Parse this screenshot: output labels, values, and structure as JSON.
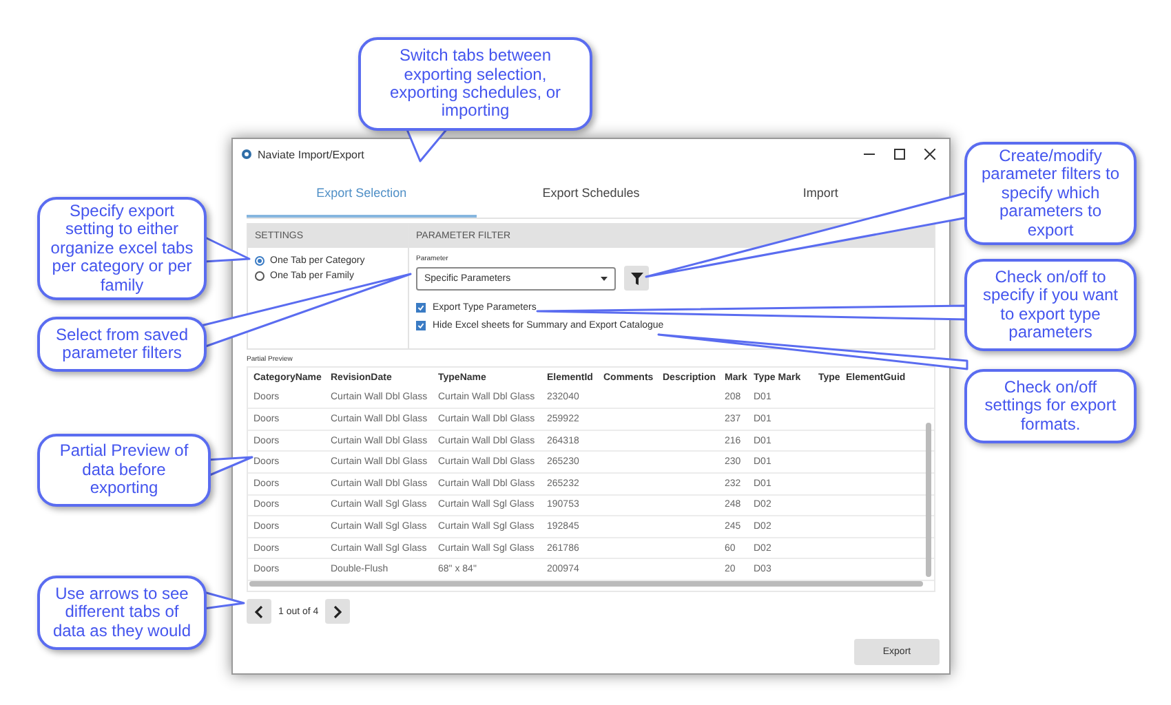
{
  "window": {
    "title": "Naviate Import/Export"
  },
  "tabs": [
    {
      "label": "Export Selection",
      "selected": true
    },
    {
      "label": "Export Schedules",
      "selected": false
    },
    {
      "label": "Import",
      "selected": false
    }
  ],
  "settings": {
    "header": "SETTINGS",
    "options": [
      {
        "label": "One Tab per Category",
        "selected": true
      },
      {
        "label": "One Tab per Family",
        "selected": false
      }
    ]
  },
  "parameter_filter": {
    "header": "PARAMETER FILTER",
    "field_label": "Parameter",
    "dropdown_value": "Specific Parameters",
    "checkboxes": [
      {
        "label": "Export Type Parameters",
        "checked": true
      },
      {
        "label": "Hide Excel sheets for Summary and Export Catalogue",
        "checked": true
      }
    ]
  },
  "preview": {
    "label": "Partial Preview",
    "columns": [
      "CategoryName",
      "RevisionDate",
      "TypeName",
      "ElementId",
      "Comments",
      "Description",
      "Mark",
      "Type Mark",
      "Type",
      "ElementGuid"
    ],
    "rows": [
      {
        "category_name": "Doors",
        "revision_date": "Curtain Wall Dbl Glass",
        "type_name": "Curtain Wall Dbl Glass",
        "element_id": "232040",
        "mark": "208",
        "type_mark": "D01"
      },
      {
        "category_name": "Doors",
        "revision_date": "Curtain Wall Dbl Glass",
        "type_name": "Curtain Wall Dbl Glass",
        "element_id": "259922",
        "mark": "237",
        "type_mark": "D01"
      },
      {
        "category_name": "Doors",
        "revision_date": "Curtain Wall Dbl Glass",
        "type_name": "Curtain Wall Dbl Glass",
        "element_id": "264318",
        "mark": "216",
        "type_mark": "D01"
      },
      {
        "category_name": "Doors",
        "revision_date": "Curtain Wall Dbl Glass",
        "type_name": "Curtain Wall Dbl Glass",
        "element_id": "265230",
        "mark": "230",
        "type_mark": "D01"
      },
      {
        "category_name": "Doors",
        "revision_date": "Curtain Wall Dbl Glass",
        "type_name": "Curtain Wall Dbl Glass",
        "element_id": "265232",
        "mark": "232",
        "type_mark": "D01"
      },
      {
        "category_name": "Doors",
        "revision_date": "Curtain Wall Sgl Glass",
        "type_name": "Curtain Wall Sgl Glass",
        "element_id": "190753",
        "mark": "248",
        "type_mark": "D02"
      },
      {
        "category_name": "Doors",
        "revision_date": "Curtain Wall Sgl Glass",
        "type_name": "Curtain Wall Sgl Glass",
        "element_id": "192845",
        "mark": "245",
        "type_mark": "D02"
      },
      {
        "category_name": "Doors",
        "revision_date": "Curtain Wall Sgl Glass",
        "type_name": "Curtain Wall Sgl Glass",
        "element_id": "261786",
        "mark": "60",
        "type_mark": "D02"
      },
      {
        "category_name": "Doors",
        "revision_date": "Double-Flush",
        "type_name": "68\" x 84\"",
        "element_id": "200974",
        "mark": "20",
        "type_mark": "D03"
      }
    ]
  },
  "pager": {
    "text": "1 out of 4"
  },
  "export_button": "Export",
  "callouts": [
    {
      "text": "Switch tabs between exporting selection, exporting schedules, or importing"
    },
    {
      "text": "Specify export setting to either organize excel tabs per category or per family"
    },
    {
      "text": "Select from saved parameter filters"
    },
    {
      "text": "Create/modify parameter filters to specify which parameters to export"
    },
    {
      "text": "Check on/off to specify if you want to export type parameters"
    },
    {
      "text": "Check on/off settings for export formats."
    },
    {
      "text": "Partial Preview of data before exporting"
    },
    {
      "text": "Use arrows to see different tabs of data as they would"
    }
  ]
}
